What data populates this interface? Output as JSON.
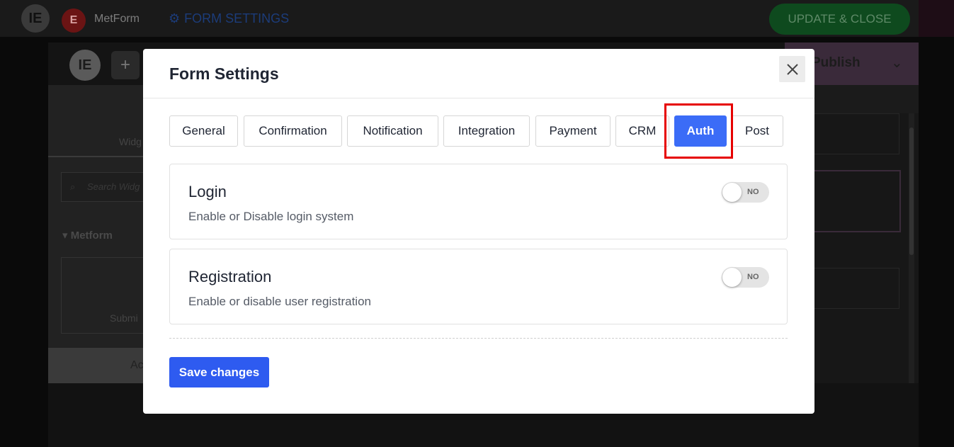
{
  "topbar": {
    "app_logo": "IE",
    "metform_logo": "E",
    "metform_name": "MetForm",
    "form_settings_link": "FORM SETTINGS",
    "update_button": "UPDATE & CLOSE"
  },
  "editor": {
    "logo": "IE",
    "add_icon": "+",
    "publish_label": "Publish",
    "widgets_tab": "Widg",
    "search_placeholder": "Search Widg",
    "group_label": "Metform",
    "widget_label": "Submi",
    "bottom_label": "Ac"
  },
  "modal": {
    "title": "Form Settings",
    "close_icon": "close-icon",
    "tabs": [
      {
        "label": "General",
        "active": false
      },
      {
        "label": "Confirmation",
        "active": false
      },
      {
        "label": "Notification",
        "active": false
      },
      {
        "label": "Integration",
        "active": false
      },
      {
        "label": "Payment",
        "active": false
      },
      {
        "label": "CRM",
        "active": false
      },
      {
        "label": "Auth",
        "active": true
      },
      {
        "label": "Post",
        "active": false
      }
    ],
    "settings": [
      {
        "title": "Login",
        "description": "Enable or Disable login system",
        "toggle_state": "NO"
      },
      {
        "title": "Registration",
        "description": "Enable or disable user registration",
        "toggle_state": "NO"
      }
    ],
    "save_button": "Save changes"
  },
  "colors": {
    "accent": "#3b6cf7",
    "save_button": "#2e5bf0",
    "highlight_box": "#e60000",
    "overlay": "#0a0a0a"
  }
}
